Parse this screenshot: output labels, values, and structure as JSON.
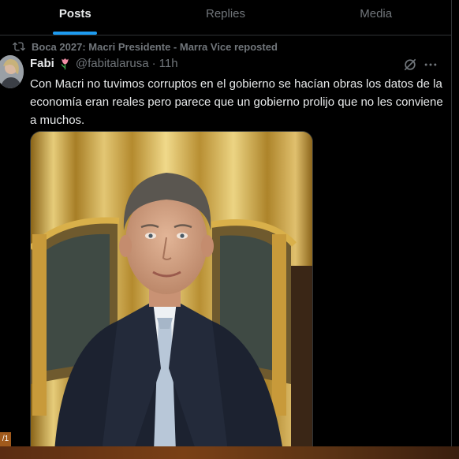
{
  "tabs": [
    {
      "label": "Posts",
      "active": true
    },
    {
      "label": "Replies",
      "active": false
    },
    {
      "label": "Media",
      "active": false
    }
  ],
  "repost": {
    "text": "Boca 2027: Macri Presidente - Marra Vice reposted",
    "icon": "repost-icon"
  },
  "tweet": {
    "name": "Fabi",
    "handle": "@fabitalarusa",
    "separator": "·",
    "time": "11h",
    "text": "Con Macri no tuvimos corruptos en el gobierno se hacían obras los datos de la economía eran reales pero parece que un gobierno prolijo que no les conviene a muchos."
  },
  "corner_tag": "/1",
  "colors": {
    "accent": "#1d9bf0",
    "background": "#000000",
    "text": "#e7e9ea",
    "muted": "#71767b"
  }
}
